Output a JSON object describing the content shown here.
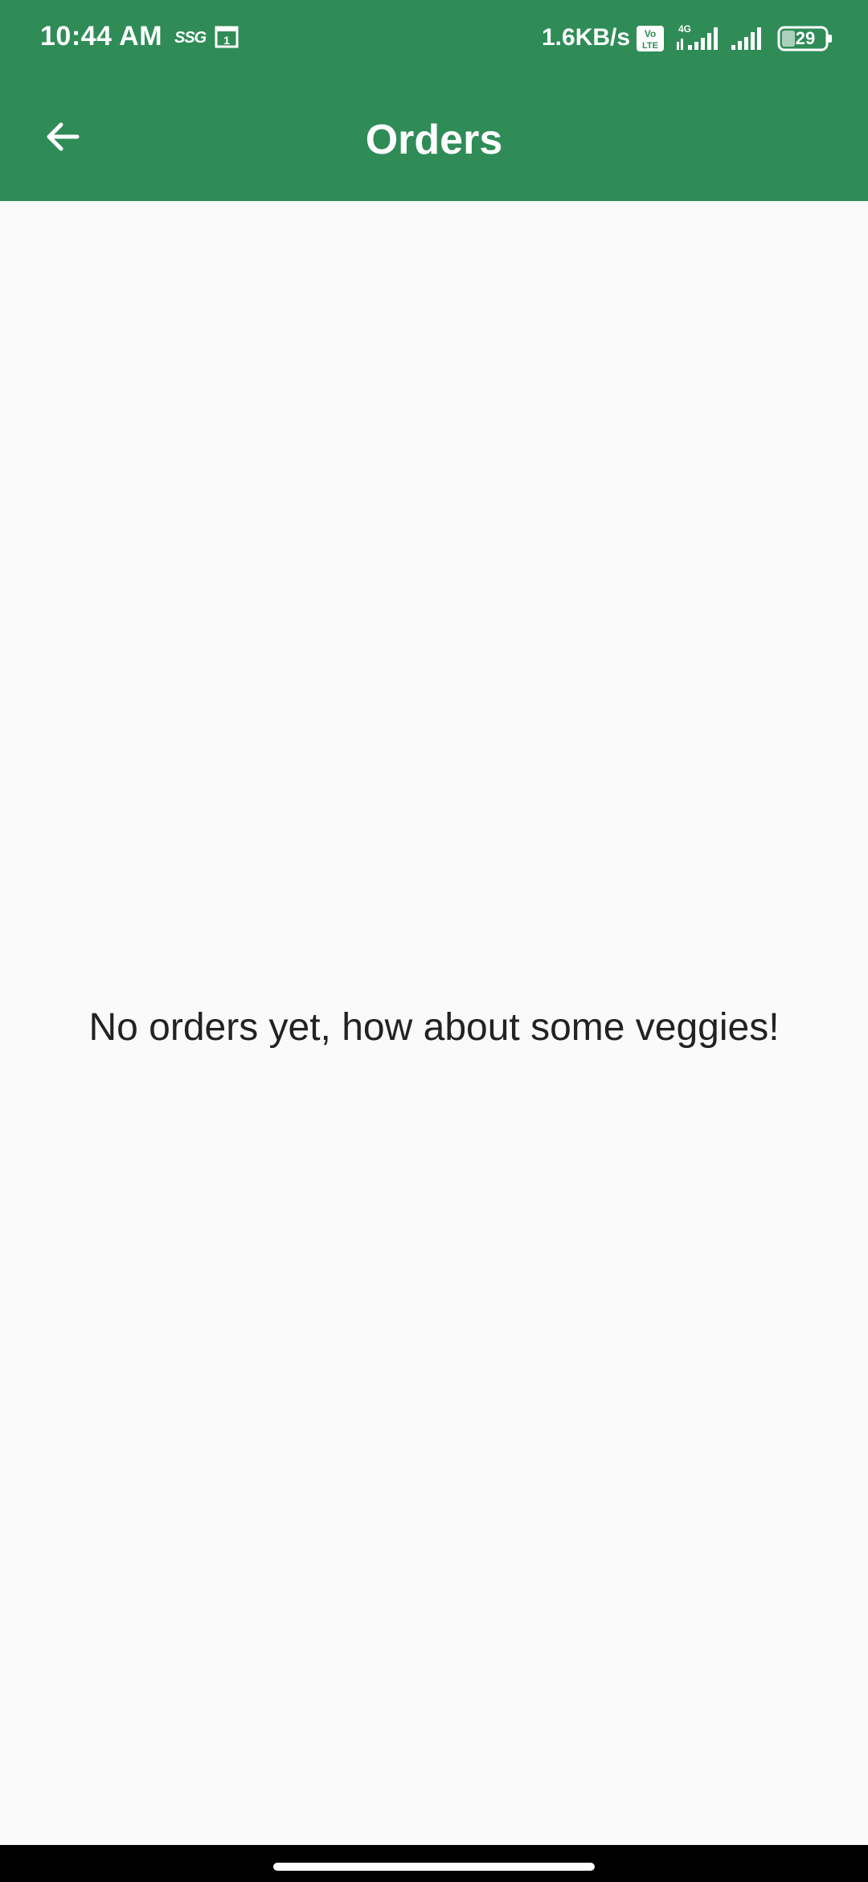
{
  "status_bar": {
    "time": "10:44 AM",
    "carrier_icon_text": "SSG",
    "calendar_day": "1",
    "net_speed": "1.6KB/s",
    "volte_label": "Vo LTE",
    "network_type": "4G",
    "battery_level": "29"
  },
  "app_bar": {
    "title": "Orders"
  },
  "main": {
    "empty_message": "No orders yet, how about some veggies!"
  },
  "colors": {
    "primary": "#2f8c57",
    "background": "#fafafa",
    "text": "#222222"
  },
  "icons": {
    "back": "arrow-left-icon",
    "calendar": "calendar-icon",
    "signal": "signal-icon",
    "battery": "battery-icon"
  }
}
